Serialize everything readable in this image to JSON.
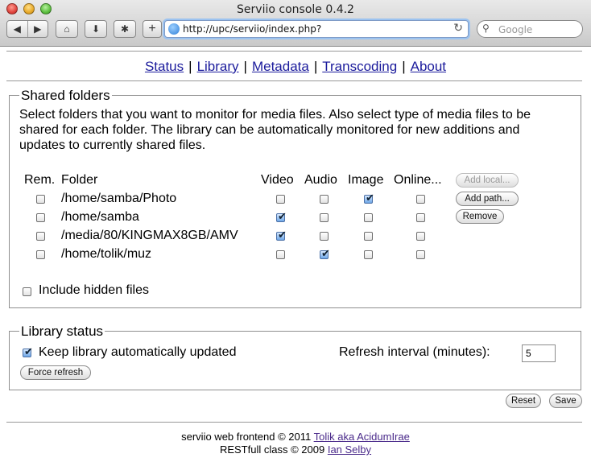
{
  "window": {
    "title": "Serviio console 0.4.2"
  },
  "toolbar": {
    "back": "◀",
    "forward": "▶",
    "home": "⌂",
    "download": "⬇",
    "gear": "✱",
    "plus": "+",
    "url": "http://upc/serviio/index.php?",
    "reload": "↻",
    "search_placeholder": "Google",
    "search_glass": "⚲"
  },
  "nav": {
    "items": [
      {
        "label": "Status"
      },
      {
        "label": "Library"
      },
      {
        "label": "Metadata"
      },
      {
        "label": "Transcoding"
      },
      {
        "label": "About"
      }
    ],
    "separator": "|"
  },
  "shared": {
    "legend": "Shared folders",
    "description": "Select folders that you want to monitor for media files. Also select type of media files to be shared for each folder. The library can be automatically monitored for new additions and updates to currently shared files.",
    "columns": {
      "rem": "Rem.",
      "folder": "Folder",
      "video": "Video",
      "audio": "Audio",
      "image": "Image",
      "online": "Online..."
    },
    "rows": [
      {
        "path": "/home/samba/Photo",
        "rem": false,
        "video": false,
        "audio": false,
        "image": true,
        "online": false
      },
      {
        "path": "/home/samba",
        "rem": false,
        "video": true,
        "audio": false,
        "image": false,
        "online": false
      },
      {
        "path": "/media/80/KINGMAX8GB/AMV",
        "rem": false,
        "video": true,
        "audio": false,
        "image": false,
        "online": false
      },
      {
        "path": "/home/tolik/muz",
        "rem": false,
        "video": false,
        "audio": true,
        "image": false,
        "online": false
      }
    ],
    "buttons": {
      "add_local": "Add local...",
      "add_path": "Add path...",
      "remove": "Remove"
    },
    "include_hidden_label": "Include hidden files",
    "include_hidden": false
  },
  "library": {
    "legend": "Library status",
    "keep_updated_label": "Keep library automatically updated",
    "keep_updated": true,
    "refresh_label": "Refresh interval (minutes):",
    "refresh_value": "5",
    "force_refresh": "Force refresh"
  },
  "actions": {
    "reset": "Reset",
    "save": "Save"
  },
  "footer": {
    "line1_prefix": "serviio web frontend © 2011",
    "line1_link": "Tolik aka AcidumIrae",
    "line2_prefix": "RESTfull class © 2009",
    "line2_link": "Ian Selby"
  }
}
